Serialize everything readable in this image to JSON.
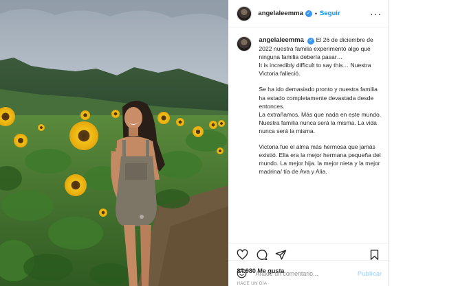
{
  "post": {
    "username": "angelaleemma",
    "follow_label": "Seguir",
    "more_icon": "more-horizontal-icon",
    "verified_icon": "verified-badge-icon"
  },
  "caption": {
    "username": "angelaleemma",
    "paragraphs": [
      "El 26 de diciembre de 2022 nuestra familia experimentó algo que ninguna familia debería pasar…",
      "It is incredibly difficult to say this… Nuestra Victoria falleció.",
      "Se ha ido demasiado pronto y nuestra familia ha estado completamente devastada desde entonces.",
      "La extrañamos. Más que nada en este mundo. Nuestra familia nunca será la misma. La vida nunca será la misma.",
      "Victoria fue el alma más hermosa que jamás existió. Ella era la mejor hermana pequeña del mundo. La mejor hija. la mejor nieta y la mejor madrina/ tía de Ava y Alia."
    ]
  },
  "actions": {
    "like_icon": "heart-icon",
    "comment_icon": "comment-bubble-icon",
    "share_icon": "paper-plane-icon",
    "save_icon": "bookmark-icon"
  },
  "likes_text": "84.980 Me gusta",
  "timestamp": "HACE UN DÍA",
  "comment_box": {
    "placeholder": "Añade un comentario...",
    "publish_label": "Publicar",
    "emoji_icon": "emoji-smile-icon"
  },
  "colors": {
    "link_blue": "#0095f6",
    "publish_disabled": "#b3dbff",
    "verified_blue": "#3897f0",
    "muted_text": "#8e8e8e"
  }
}
